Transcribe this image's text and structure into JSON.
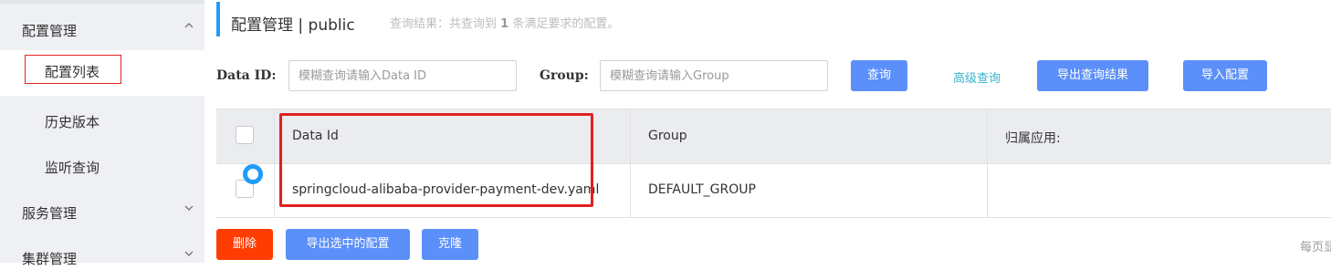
{
  "sidebar": {
    "config_group": "配置管理",
    "items": [
      {
        "label": "配置列表"
      },
      {
        "label": "历史版本"
      },
      {
        "label": "监听查询"
      }
    ],
    "service_group": "服务管理",
    "cluster_group": "集群管理"
  },
  "header": {
    "title": "配置管理 | public",
    "result_prefix": "查询结果：共查询到",
    "result_count": "1",
    "result_suffix": "条满足要求的配置。"
  },
  "filters": {
    "dataid_label": "Data ID:",
    "dataid_placeholder": "模糊查询请输入Data ID",
    "group_label": "Group:",
    "group_placeholder": "模糊查询请输入Group",
    "query_button": "查询",
    "advanced_link": "高级查询",
    "export_results_button": "导出查询结果",
    "import_button": "导入配置"
  },
  "table": {
    "columns": [
      "Data Id",
      "Group",
      "归属应用:"
    ],
    "rows": [
      {
        "data_id": "springcloud-alibaba-provider-payment-dev.yaml",
        "group": "DEFAULT_GROUP",
        "app": ""
      }
    ]
  },
  "actions": {
    "delete": "删除",
    "export_selected": "导出选中的配置",
    "clone": "克隆"
  },
  "pagination": {
    "per_page_label": "每页显示"
  },
  "colors": {
    "primary": "#5b8ff9",
    "danger": "#ff3d00",
    "accent_bar": "#209bfa",
    "highlight_red": "#e02020",
    "link": "#33b6cc"
  }
}
